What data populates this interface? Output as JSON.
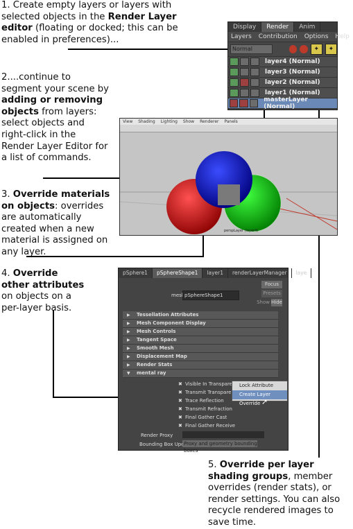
{
  "notes": {
    "n1": {
      "pre": "1. Create empty layers or layers with selected objects in the ",
      "b1": "Render Layer editor",
      "post": " (floating or docked; this can be enabled in preferences)..."
    },
    "n2": {
      "pre": "2....continue to segment your scene by ",
      "b1": "adding or removing objects",
      "post": " from layers: select objects and right-click in the Render Layer Editor for a list of commands."
    },
    "n3": {
      "pre": "3. ",
      "b1": "Override materials on objects",
      "post": ": overrides are automatically created when a new material is assigned on any layer."
    },
    "n4": {
      "pre": "4. ",
      "b1": "Override other attributes",
      "post": " on objects on a per-layer basis."
    },
    "n5": {
      "pre": "5. ",
      "b1": "Override per layer shading groups",
      "post": ", member overrides (render stats), or render settings. You can also recycle rendered images to save time."
    }
  },
  "render_layer_editor": {
    "tabs": [
      "Display",
      "Render",
      "Anim"
    ],
    "menus": [
      "Layers",
      "Contribution",
      "Options",
      "Help"
    ],
    "dropdown": "Normal",
    "layers": [
      "layer4 (Normal)",
      "layer3 (Normal)",
      "layer2 (Normal)",
      "layer1 (Normal)",
      "masterLayer (Normal)"
    ]
  },
  "viewport": {
    "menus": [
      "View",
      "Shading",
      "Lighting",
      "Show",
      "Renderer",
      "Panels"
    ],
    "label": "perspLayer (layer4)"
  },
  "attribute_editor": {
    "tabs": [
      "pSphere1",
      "pSphereShape1",
      "layer1",
      "renderLayerManager",
      "laye"
    ],
    "mesh_label": "mesh:",
    "mesh_value": "pSphereShape1",
    "focus": "Focus",
    "presets": "Presets",
    "show": "Show",
    "hide": "Hide",
    "sections": [
      "Tessellation Attributes",
      "Mesh Component Display",
      "Mesh Controls",
      "Tangent Space",
      "Smooth Mesh",
      "Displacement Map",
      "Render Stats",
      "mental ray"
    ],
    "checkboxes": [
      "Visible In Transparency",
      "Transmit Transparency",
      "Trace Reflection",
      "Transmit Refraction",
      "Final Gather Cast",
      "Final Gather Receive"
    ],
    "popup": [
      "Lock Attribute",
      "Create Layer Override"
    ],
    "render_proxy": "Render Proxy",
    "bbox_label": "Bounding Box Update",
    "bbox_value": "Proxy and geometry bounding boxes"
  }
}
